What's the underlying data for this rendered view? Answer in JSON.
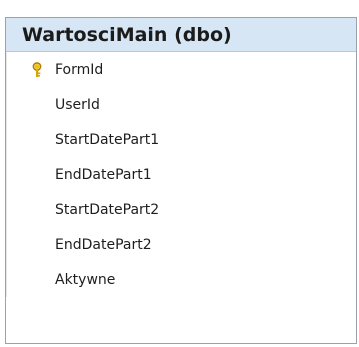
{
  "table": {
    "title": "WartosciMain (dbo)",
    "columns": [
      {
        "label": "FormId",
        "primary_key": true,
        "key_icon": "primary-key-icon"
      },
      {
        "label": "UserId",
        "primary_key": false
      },
      {
        "label": "StartDatePart1",
        "primary_key": false
      },
      {
        "label": "EndDatePart1",
        "primary_key": false
      },
      {
        "label": "StartDatePart2",
        "primary_key": false
      },
      {
        "label": "EndDatePart2",
        "primary_key": false
      },
      {
        "label": "Aktywne",
        "primary_key": false
      }
    ],
    "colors": {
      "title_bar": "#d7e6f5",
      "key_icon": "#d9a400"
    }
  }
}
